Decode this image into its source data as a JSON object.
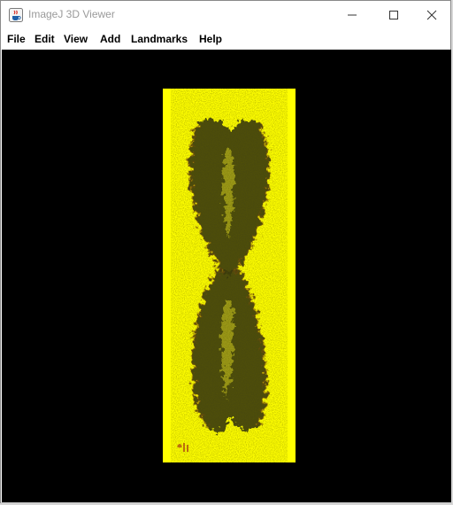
{
  "window": {
    "title": "ImageJ 3D Viewer",
    "icon": "java-coffee-icon",
    "controls": [
      "minimize-icon",
      "maximize-icon",
      "close-icon"
    ]
  },
  "menu": {
    "items": [
      {
        "label": "File"
      },
      {
        "label": "Edit"
      },
      {
        "label": "View"
      },
      {
        "label": "Add"
      },
      {
        "label": "Landmarks"
      },
      {
        "label": "Help"
      }
    ]
  },
  "viewer": {
    "background_color": "#000000",
    "panel_color": "#ffff00",
    "specimen_color": "#2a2a0a"
  }
}
